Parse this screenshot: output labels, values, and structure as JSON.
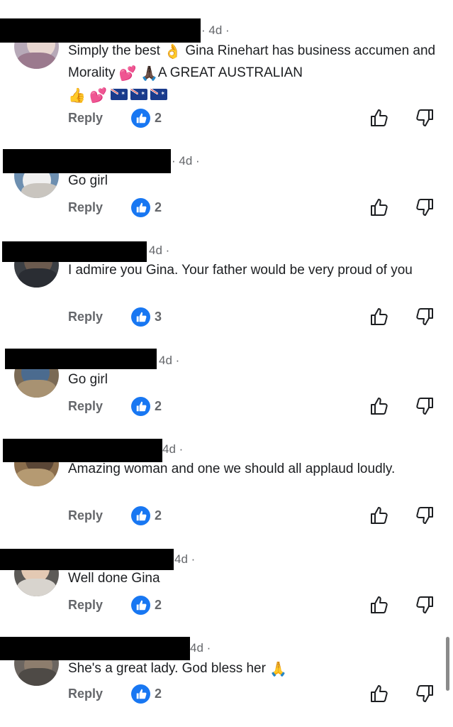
{
  "comments": [
    {
      "author": "",
      "time": "4d",
      "text_before": "Simply the best ",
      "e1": "👌",
      "text_mid": " Gina Rinehart has business accumen and Morality ",
      "e2": "💕",
      "e3": "🙏🏿",
      "text_after": "A GREAT AUSTRALIAN",
      "e4": "👍",
      "e5": "💕",
      "reply": "Reply",
      "likes": "2"
    },
    {
      "author": "",
      "time": "4d",
      "text": "Go girl",
      "reply": "Reply",
      "likes": "2"
    },
    {
      "author": "",
      "time": "4d",
      "text": "I admire you Gina. Your father would be very proud of you",
      "reply": "Reply",
      "likes": "3"
    },
    {
      "author": "",
      "time": "4d",
      "text": "Go girl",
      "reply": "Reply",
      "likes": "2"
    },
    {
      "author": "",
      "time": "4d",
      "text": "Amazing woman and one we should all applaud loudly.",
      "reply": "Reply",
      "likes": "2"
    },
    {
      "author": "",
      "time": "4d",
      "text": "Well done Gina",
      "reply": "Reply",
      "likes": "2"
    },
    {
      "author": "",
      "time": "4d",
      "text_before": "She's a great lady.  God bless her ",
      "e1": "🙏",
      "reply": "Reply",
      "likes": "2"
    }
  ],
  "icons": {
    "like_badge": "like-badge-icon",
    "thumbs_up": "thumbs-up-icon",
    "thumbs_down": "thumbs-down-icon"
  },
  "colors": {
    "like_blue": "#1877f2",
    "meta_gray": "#65676b",
    "redaction": "#000000"
  }
}
